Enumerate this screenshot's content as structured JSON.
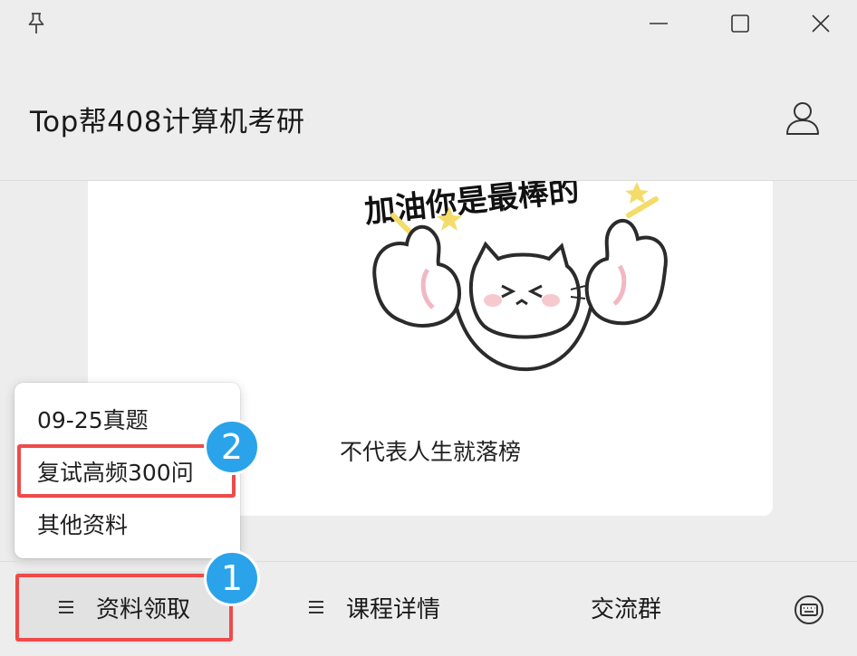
{
  "app": {
    "title": "Top帮408计算机考研"
  },
  "chat": {
    "message_text": "不代表人生就落榜",
    "sticker": {
      "caption": "加油你是最棒的"
    }
  },
  "popup_menu": {
    "items": [
      {
        "label": "09-25真题"
      },
      {
        "label": "复试高频300问"
      },
      {
        "label": "其他资料"
      }
    ]
  },
  "bottom_menu": {
    "items": [
      {
        "label": "资料领取",
        "icon": "hamburger-icon"
      },
      {
        "label": "课程详情",
        "icon": "hamburger-icon"
      },
      {
        "label": "交流群"
      }
    ],
    "keyboard_icon": "keyboard-icon"
  },
  "annotations": {
    "badge_1": "1",
    "badge_2": "2",
    "highlight_color": "#ee4a4a",
    "badge_color": "#2aa3ea"
  }
}
